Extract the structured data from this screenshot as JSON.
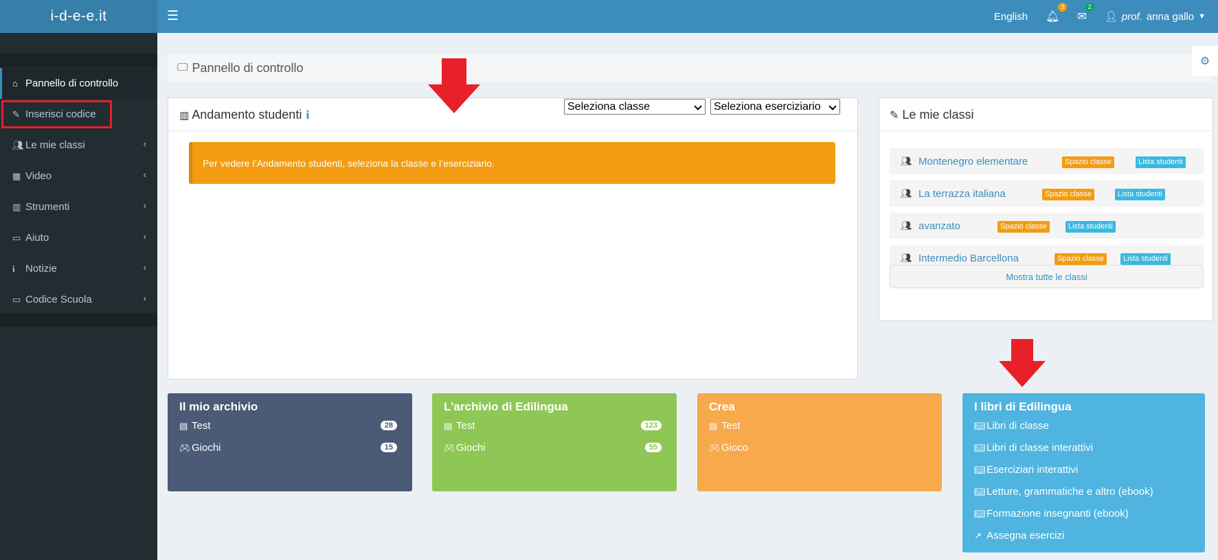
{
  "header": {
    "logo": "i-d-e-e.it",
    "menu_icon": "hamburger-icon",
    "language": "English",
    "notifications_count": "3",
    "messages_count": "2",
    "user_prefix": "prof.",
    "user_name": "anna gallo"
  },
  "sidebar": {
    "items": [
      {
        "label": "Pannello di controllo",
        "icon": "home-icon"
      },
      {
        "label": "Inserisci codice",
        "icon": "edit-icon"
      },
      {
        "label": "Le mie classi",
        "icon": "users-icon"
      },
      {
        "label": "Video",
        "icon": "film-icon"
      },
      {
        "label": "Strumenti",
        "icon": "bar-chart-icon"
      },
      {
        "label": "Aiuto",
        "icon": "laptop-icon"
      },
      {
        "label": "Notizie",
        "icon": "info-icon"
      },
      {
        "label": "Codice Scuola",
        "icon": "laptop-icon"
      }
    ]
  },
  "page": {
    "title": "Pannello di controllo"
  },
  "students": {
    "title": "Andamento studenti",
    "select_class": "Seleziona classe",
    "select_workbook": "Seleziona eserciziario",
    "alert": "Per vedere l’Andamento studenti, seleziona la classe e l’eserciziario."
  },
  "classes": {
    "title": "Le mie classi",
    "rows": [
      {
        "name": "Montenegro elementare",
        "space": "Spazio classe",
        "list": "Lista studenti"
      },
      {
        "name": "La terrazza italiana",
        "space": "Spazio classe",
        "list": "Lista studenti"
      },
      {
        "name": "avanzato",
        "space": "Spazio classe",
        "list": "Lista studenti"
      },
      {
        "name": "Intermedio Barcellona",
        "space": "Spazio classe",
        "list": "Lista studenti"
      }
    ],
    "show_all": "Mostra tutte le classi"
  },
  "tiles": {
    "archive": {
      "title": "Il mio archivio",
      "test": "Test",
      "test_count": "28",
      "games": "Giochi",
      "games_count": "15"
    },
    "edilingua_archive": {
      "title": "L'archivio di Edilingua",
      "test": "Test",
      "test_count": "123",
      "games": "Giochi",
      "games_count": "55"
    },
    "create": {
      "title": "Crea",
      "test": "Test",
      "game": "Gioco"
    },
    "books": {
      "title": "I libri di Edilingua",
      "items": [
        "Libri di classe",
        "Libri di classe interattivi",
        "Eserciziari interattivi",
        "Letture, grammatiche e altro (ebook)",
        "Formazione insegnanti (ebook)",
        "Assegna esercizi"
      ]
    }
  },
  "colors": {
    "header": "#3c8dbc",
    "sidebar": "#222d32",
    "alert": "#f39c12",
    "tile_archive": "#4a5a77",
    "tile_edilingua": "#8fc756",
    "tile_create": "#f7a94b",
    "tile_books": "#4fb4df",
    "annotation_red": "#e8202a"
  }
}
